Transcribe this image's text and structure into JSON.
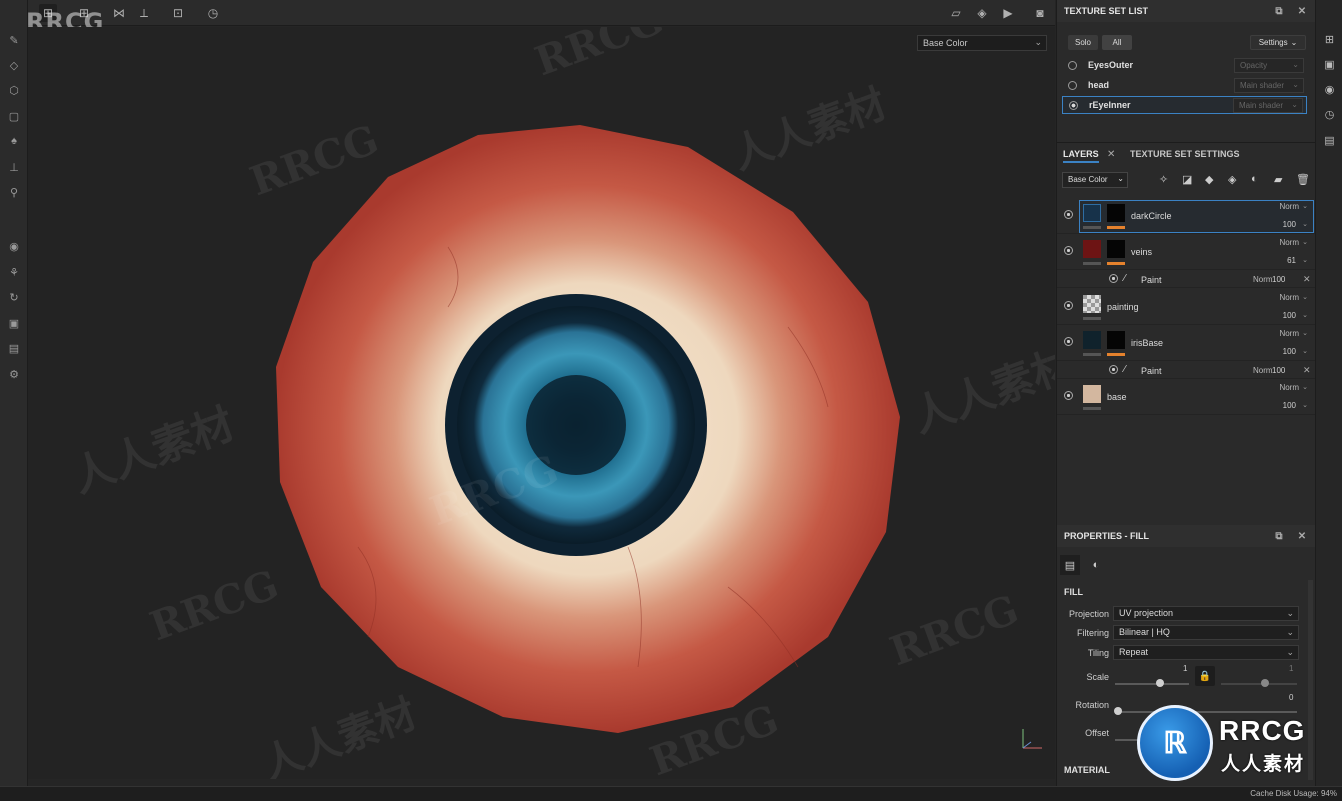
{
  "watermark": {
    "logo": "RRCG",
    "cn": "人人素材",
    "badge_text": "RRCG",
    "badge_cn": "人人素材"
  },
  "viewport": {
    "channel_select": "Base Color"
  },
  "texture_set_list": {
    "title": "TEXTURE SET LIST",
    "solo_label": "Solo",
    "all_label": "All",
    "settings_label": "Settings",
    "items": [
      {
        "name": "EyesOuter",
        "shader": "Opacity",
        "selected": false
      },
      {
        "name": "head",
        "shader": "Main shader",
        "selected": false
      },
      {
        "name": "rEyeInner",
        "shader": "Main shader",
        "selected": true
      }
    ]
  },
  "layers": {
    "tab_layers": "LAYERS",
    "tab_texture_set_settings": "TEXTURE SET SETTINGS",
    "channel_select": "Base Color",
    "rows": [
      {
        "name": "darkCircle",
        "blend": "Norm",
        "opacity": "100"
      },
      {
        "name": "veins",
        "blend": "Norm",
        "opacity": "61"
      },
      {
        "name": "Paint",
        "blend": "Norm",
        "opacity": "100"
      },
      {
        "name": "painting",
        "blend": "Norm",
        "opacity": "100"
      },
      {
        "name": "irisBase",
        "blend": "Norm",
        "opacity": "100"
      },
      {
        "name": "Paint",
        "blend": "Norm",
        "opacity": "100"
      },
      {
        "name": "base",
        "blend": "Norm",
        "opacity": "100"
      }
    ]
  },
  "properties": {
    "title": "PROPERTIES - FILL",
    "section_fill": "FILL",
    "projection_label": "Projection",
    "projection_value": "UV projection",
    "filtering_label": "Filtering",
    "filtering_value": "Bilinear | HQ",
    "tiling_label": "Tiling",
    "tiling_value": "Repeat",
    "scale_label": "Scale",
    "scale_value_1": "1",
    "scale_value_2": "1",
    "rotation_label": "Rotation",
    "rotation_value": "0",
    "offset_label": "Offset",
    "section_material": "MATERIAL"
  },
  "status": {
    "text": "Cache Disk Usage:   94%"
  }
}
